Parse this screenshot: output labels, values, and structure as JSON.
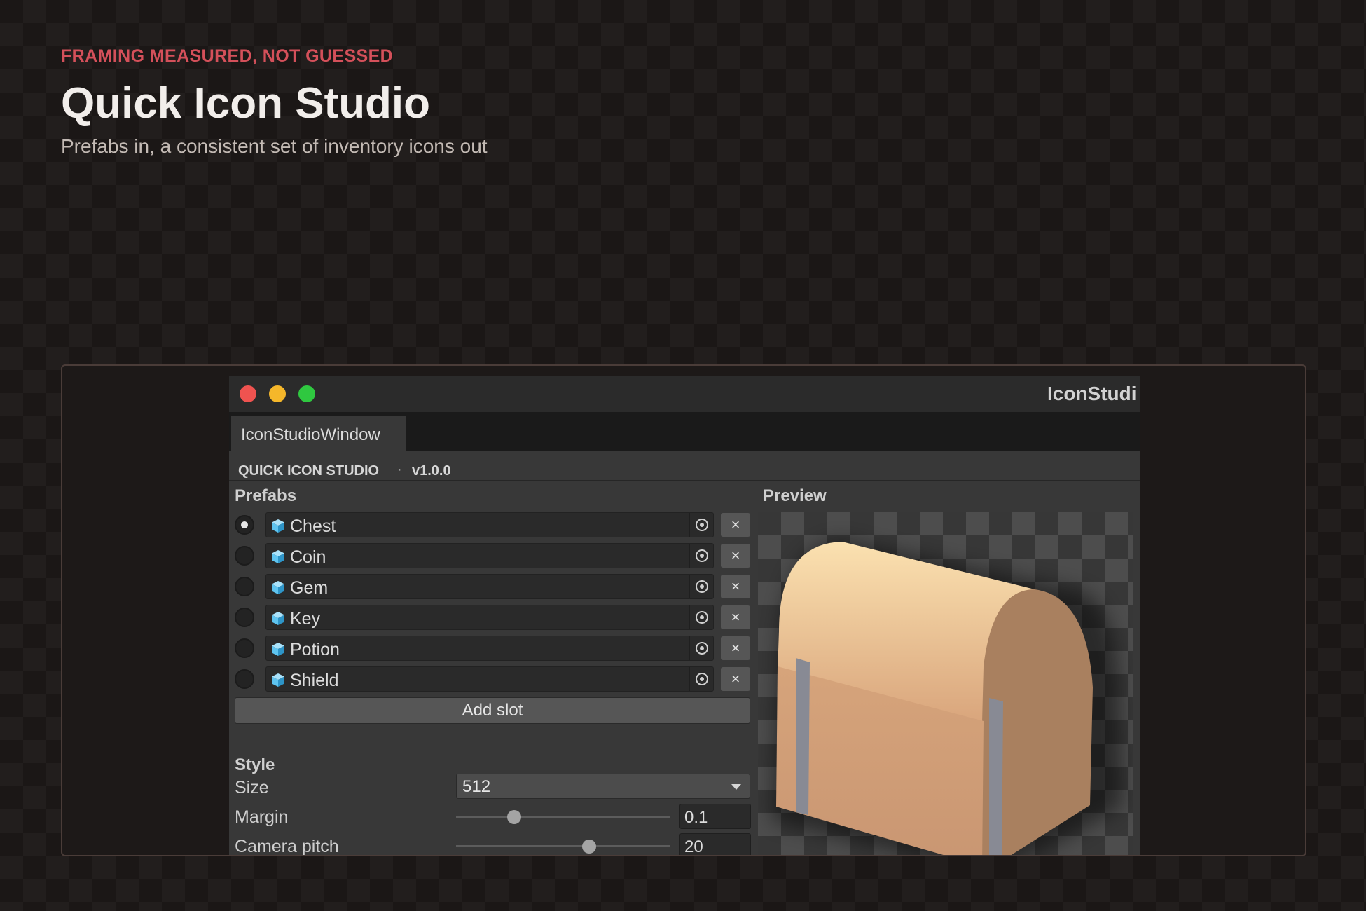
{
  "hero": {
    "eyebrow": "FRAMING MEASURED, NOT GUESSED",
    "title": "Quick Icon Studio",
    "subtitle": "Prefabs in, a consistent set of inventory icons out"
  },
  "window": {
    "title": "IconStudi",
    "tab": "IconStudioWindow",
    "app_name": "QUICK ICON STUDIO",
    "separator": "·",
    "version": "v1.0.0"
  },
  "prefabs": {
    "heading": "Prefabs",
    "selected_index": 0,
    "slots": [
      {
        "name": "Chest"
      },
      {
        "name": "Coin"
      },
      {
        "name": "Gem"
      },
      {
        "name": "Key"
      },
      {
        "name": "Potion"
      },
      {
        "name": "Shield"
      }
    ],
    "remove_glyph": "×",
    "add_slot_label": "Add slot",
    "slot_icon": "prefab-cube-icon"
  },
  "style": {
    "heading": "Style",
    "size": {
      "label": "Size",
      "value": "512"
    },
    "margin": {
      "label": "Margin",
      "value": "0.1",
      "fraction": 0.27
    },
    "camera_pitch": {
      "label": "Camera pitch",
      "value": "20",
      "fraction": 0.62
    }
  },
  "preview": {
    "heading": "Preview",
    "subject_icon": "treasure-chest-icon"
  },
  "colors": {
    "eyebrow": "#d4505a",
    "cube_icon": "#5ec4f0",
    "chest_front": "#cf9d76",
    "chest_lid": "#f6cf9b",
    "chest_strap": "#888a94"
  }
}
